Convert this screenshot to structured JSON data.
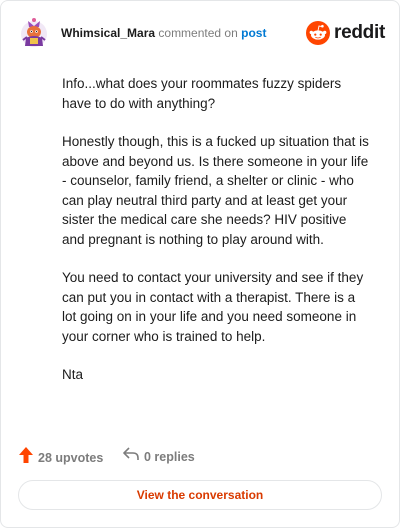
{
  "header": {
    "username": "Whimsical_Mara",
    "action": "commented on",
    "post_link": "post",
    "brand": "reddit",
    "avatar_icon": "snoo-avatar-icon",
    "brand_icon": "reddit-logo-icon"
  },
  "comment": {
    "paragraphs": [
      "Info...what does your roommates fuzzy spiders have to do with anything?",
      "Honestly though, this is a fucked up situation that is above and beyond us. Is there someone in your life - counselor, family friend, a shelter or clinic - who can play neutral third party and at least get your sister the medical care she needs? HIV positive and pregnant is nothing to play around with.",
      "You need to contact your university and see if they can put you in contact with a therapist. There is a lot going on in your life and you need someone in your corner who is trained to help.",
      "Nta"
    ]
  },
  "footer": {
    "upvotes": "28 upvotes",
    "replies": "0 replies",
    "upvote_icon": "upvote-arrow-icon",
    "reply_icon": "reply-arrow-icon",
    "upvote_color": "#ff4500"
  },
  "view_button": {
    "label": "View the conversation",
    "color": "#d93a00"
  }
}
